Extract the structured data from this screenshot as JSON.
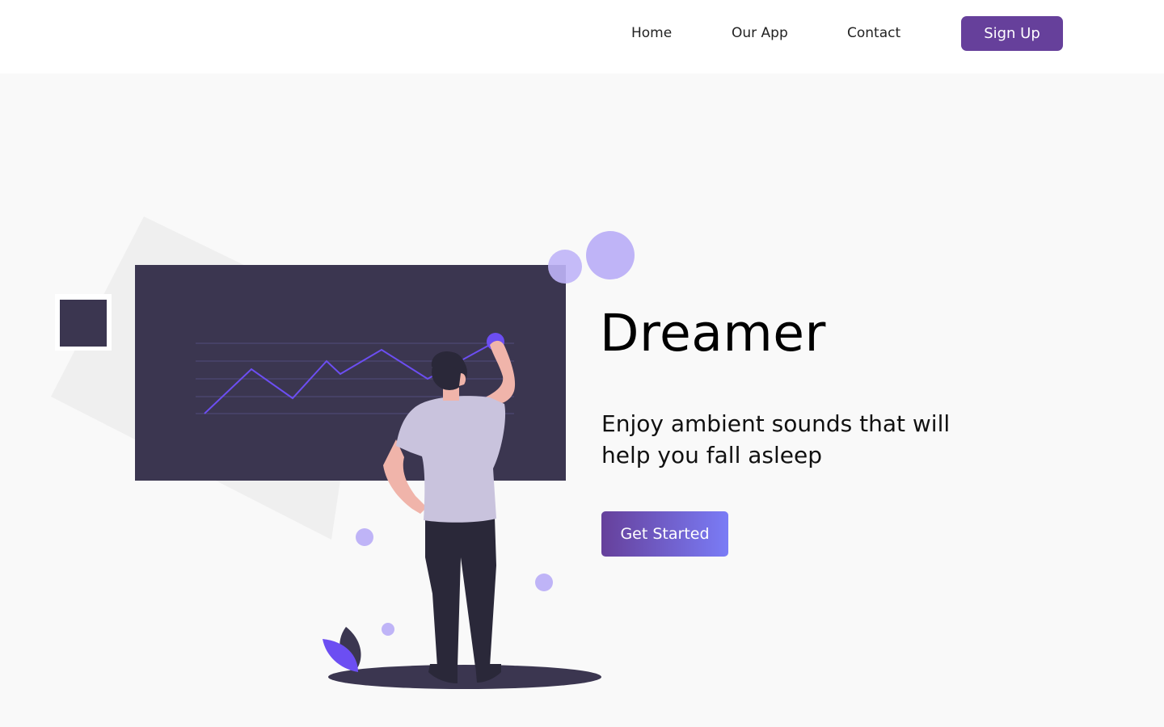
{
  "nav": {
    "items": [
      {
        "label": "Home"
      },
      {
        "label": "Our App"
      },
      {
        "label": "Contact"
      }
    ],
    "signup_label": "Sign Up"
  },
  "hero": {
    "title": "Dreamer",
    "subtitle": "Enjoy ambient sounds that will help you fall asleep",
    "cta_label": "Get Started"
  },
  "colors": {
    "brand_purple": "#66409b",
    "gradient_end": "#7a7cf6",
    "illustration_dark": "#3b3650",
    "accent_lavender": "#bfb4f7",
    "accent_violet": "#6c4ef2"
  },
  "illustration": {
    "description_icon": "person-at-whiteboard-chart-illustration"
  }
}
